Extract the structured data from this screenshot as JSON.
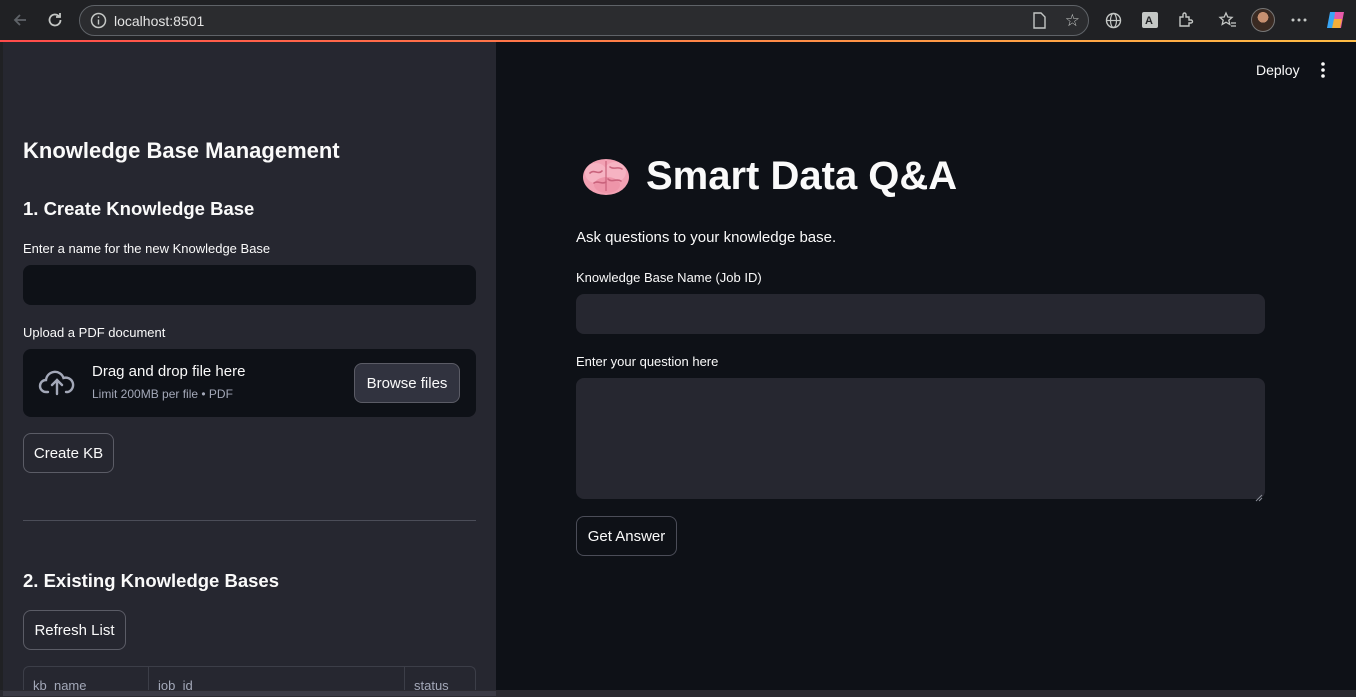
{
  "browser": {
    "url": "localhost:8501"
  },
  "sidebar": {
    "title": "Knowledge Base Management",
    "create_section": {
      "heading": "1. Create Knowledge Base",
      "name_label": "Enter a name for the new Knowledge Base",
      "name_value": "",
      "upload_label": "Upload a PDF document",
      "drop_text": "Drag and drop file here",
      "limit_text": "Limit 200MB per file • PDF",
      "browse_label": "Browse files",
      "create_label": "Create KB"
    },
    "existing_section": {
      "heading": "2. Existing Knowledge Bases",
      "refresh_label": "Refresh List",
      "columns": [
        "kb_name",
        "job_id",
        "status"
      ]
    }
  },
  "main": {
    "deploy_label": "Deploy",
    "title": "Smart Data Q&A",
    "title_icon": "brain-icon",
    "subtitle": "Ask questions to your knowledge base.",
    "kb_label": "Knowledge Base Name (Job ID)",
    "kb_value": "",
    "question_label": "Enter your question here",
    "question_value": "",
    "answer_button": "Get Answer"
  },
  "colors": {
    "sidebar_bg": "#262730",
    "main_bg": "#0e1117",
    "text": "#fafafa",
    "accent": "#ff4b4b"
  }
}
